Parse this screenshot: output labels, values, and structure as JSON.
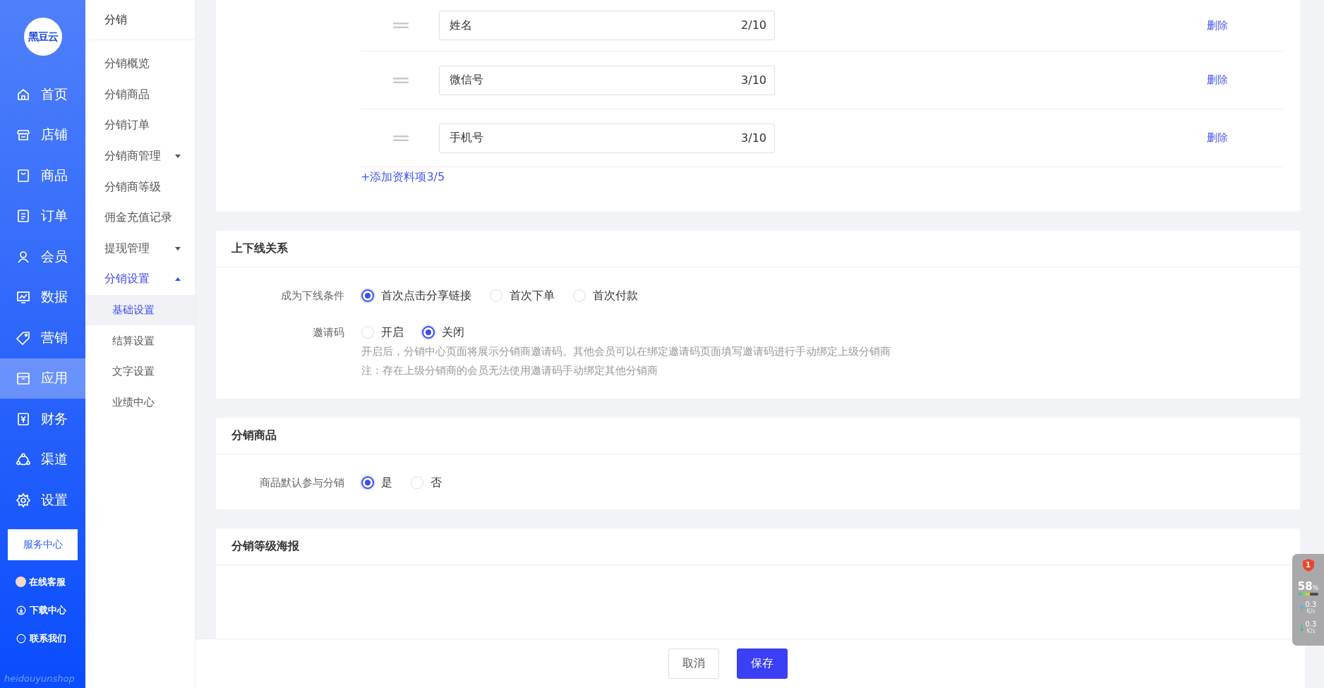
{
  "sidebar": {
    "logo": "黑豆云",
    "items": [
      {
        "label": "首页",
        "selected": false
      },
      {
        "label": "店铺",
        "selected": false
      },
      {
        "label": "商品",
        "selected": false
      },
      {
        "label": "订单",
        "selected": false
      },
      {
        "label": "会员",
        "selected": false
      },
      {
        "label": "数据",
        "selected": false
      },
      {
        "label": "营销",
        "selected": false
      },
      {
        "label": "应用",
        "selected": true
      },
      {
        "label": "财务",
        "selected": false
      },
      {
        "label": "渠道",
        "selected": false
      },
      {
        "label": "设置",
        "selected": false
      }
    ],
    "service_button": "服务中心",
    "links": [
      {
        "label": "在线客服"
      },
      {
        "label": "下载中心"
      },
      {
        "label": "联系我们"
      }
    ],
    "footer_text": "heidouyunshop"
  },
  "subnav": {
    "title": "分销",
    "items": [
      {
        "label": "分销概览",
        "selected": false
      },
      {
        "label": "分销商品",
        "selected": false
      },
      {
        "label": "分销订单",
        "selected": false
      },
      {
        "label": "分销商管理",
        "selected": false,
        "expanded": false
      },
      {
        "label": "分销商等级",
        "selected": false
      },
      {
        "label": "佣金充值记录",
        "selected": false
      },
      {
        "label": "提现管理",
        "selected": false,
        "expanded": false
      },
      {
        "label": "分销设置",
        "selected": true,
        "expanded": true,
        "children": [
          {
            "label": "基础设置",
            "selected": true
          },
          {
            "label": "结算设置",
            "selected": false
          },
          {
            "label": "文字设置",
            "selected": false
          },
          {
            "label": "业绩中心",
            "selected": false
          }
        ]
      }
    ]
  },
  "info_fields": [
    {
      "value": "姓名",
      "count": "2/10",
      "action": "删除"
    },
    {
      "value": "微信号",
      "count": "3/10",
      "action": "删除"
    },
    {
      "value": "手机号",
      "count": "3/10",
      "action": "删除"
    }
  ],
  "add_link": "+添加资料项3/5",
  "sections": [
    {
      "title": "上下线关系",
      "rows": [
        {
          "label": "成为下线条件",
          "options": [
            {
              "label": "首次点击分享链接",
              "selected": true
            },
            {
              "label": "首次下单",
              "selected": false
            },
            {
              "label": "首次付款",
              "selected": false
            }
          ]
        },
        {
          "label": "邀请码",
          "options": [
            {
              "label": "开启",
              "selected": false
            },
            {
              "label": "关闭",
              "selected": true
            }
          ],
          "notes": [
            "开启后，分销中心页面将展示分销商邀请码。其他会员可以在绑定邀请码页面填写邀请码进行手动绑定上级分销商",
            "注：存在上级分销商的会员无法使用邀请码手动绑定其他分销商"
          ]
        }
      ]
    },
    {
      "title": "分销商品",
      "rows": [
        {
          "label": "商品默认参与分销",
          "options": [
            {
              "label": "是",
              "selected": true
            },
            {
              "label": "否",
              "selected": false
            }
          ]
        }
      ]
    },
    {
      "title": "分销等级海报"
    }
  ],
  "footer_buttons": [
    {
      "label": "取消",
      "kind": "secondary"
    },
    {
      "label": "保存",
      "kind": "primary"
    }
  ],
  "monitor": {
    "badge": "1",
    "percent": "58",
    "unit": "%",
    "level": 0.58,
    "upload": "0.3",
    "upload_unit": "K/s",
    "download": "0.3",
    "download_unit": "K/s"
  }
}
